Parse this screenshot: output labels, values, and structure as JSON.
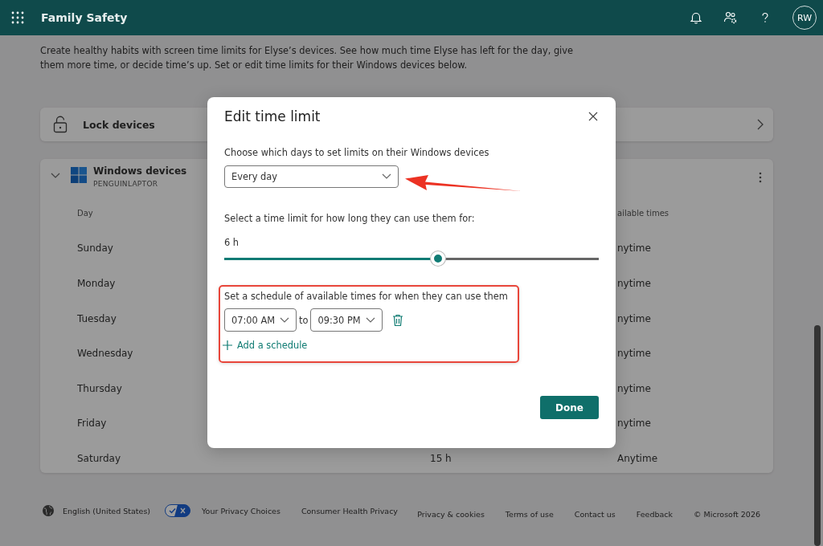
{
  "app": {
    "title": "Family Safety",
    "avatar": "RW"
  },
  "intro": "Create healthy habits with screen time limits for Elyse’s devices. See how much time Elyse has left for the day, give them more time, or decide time’s up. Set or edit time limits for their Windows devices below.",
  "lock_card": {
    "label": "Lock devices"
  },
  "device_card": {
    "title": "Windows devices",
    "subtitle": "PENGUINLAPTOR",
    "expanded": true,
    "header": {
      "column_1": "Day",
      "column_3": "ailable times"
    },
    "rows": [
      {
        "column_1": "Sunday",
        "column_3": "nytime"
      },
      {
        "column_1": "Monday",
        "column_3": "nytime"
      },
      {
        "column_1": "Tuesday",
        "column_3": "nytime"
      },
      {
        "column_1": "Wednesday",
        "column_3": "nytime"
      },
      {
        "column_1": "Thursday",
        "column_3": "nytime"
      },
      {
        "column_1": "Friday",
        "column_3": "nytime"
      },
      {
        "column_1": "Saturday",
        "column_2": "15 h",
        "column_3": "Anytime"
      }
    ]
  },
  "dialog": {
    "title": "Edit time limit",
    "days_label": "Choose which days to set limits on their Windows devices",
    "days_select": {
      "value": "Every day"
    },
    "limit_label": "Select a time limit for how long they can use them for:",
    "limit_reading": "6 h",
    "limit_slider": {
      "level": 0.571
    },
    "schedule_label": "Set a schedule of available times for when they can use them",
    "schedules": [
      {
        "from": "07:00 AM",
        "separator": "to",
        "until": "09:30 PM"
      }
    ],
    "add_schedule": "Add a schedule",
    "done": "Done"
  },
  "footer": {
    "language": "English (United States)",
    "privacy_choices": "Your Privacy Choices",
    "health_privacy": "Consumer Health Privacy",
    "links": [
      "Privacy & cookies",
      "Terms of use",
      "Contact us",
      "Feedback"
    ],
    "copyright": "© Microsoft 2026"
  }
}
